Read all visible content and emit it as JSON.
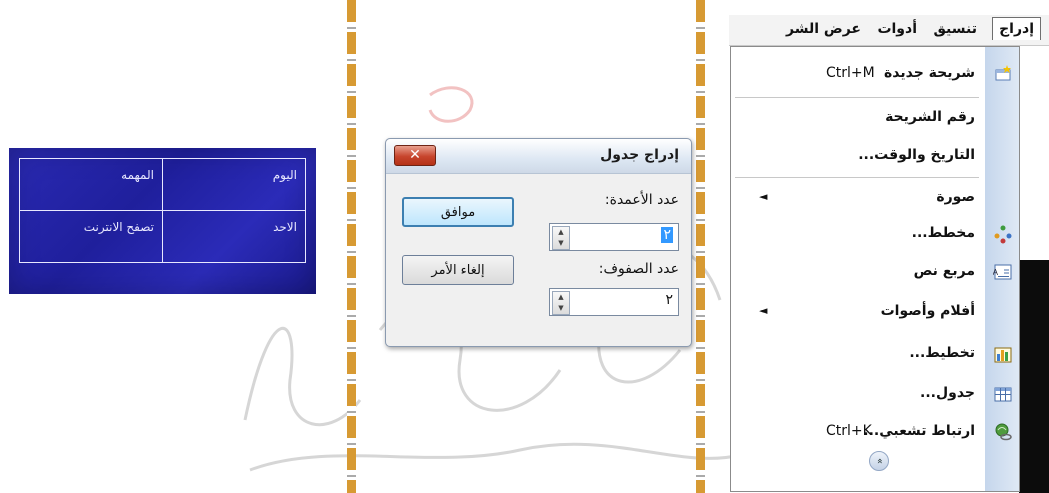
{
  "slide_table": {
    "rows": [
      [
        "اليوم",
        "المهمه"
      ],
      [
        "الاحد",
        "تصفح الانترنت"
      ]
    ]
  },
  "dialog": {
    "title": "إدراج جدول",
    "close_glyph": "✕",
    "columns_label": "عدد الأعمدة:",
    "columns_value": "٢",
    "rows_label": "عدد الصفوف:",
    "rows_value": "٢",
    "ok_label": "موافق",
    "cancel_label": "إلغاء الأمر"
  },
  "menubar": {
    "items": [
      "إدراج",
      "تنسيق",
      "أدوات",
      "عرض الشر"
    ]
  },
  "menu": {
    "new_slide": {
      "label": "شريحة جديدة",
      "shortcut": "Ctrl+M",
      "icon": "new-slide-icon"
    },
    "slide_number": {
      "label": "رقم الشريحة"
    },
    "date_time": {
      "label": "التاريخ والوقت..."
    },
    "picture": {
      "label": "صورة",
      "arrow": "◄"
    },
    "diagram": {
      "label": "مخطط...",
      "icon": "diagram-icon"
    },
    "text_box": {
      "label": "مربع نص",
      "icon": "text-box-icon"
    },
    "movies_sounds": {
      "label": "أفلام وأصوات",
      "arrow": "◄"
    },
    "chart": {
      "label": "تخطيط...",
      "icon": "chart-icon"
    },
    "table": {
      "label": "جدول...",
      "icon": "table-icon"
    },
    "hyperlink": {
      "label": "ارتباط تشعبي...",
      "shortcut": "Ctrl+K",
      "icon": "hyperlink-icon"
    },
    "expand_glyph": "»"
  }
}
